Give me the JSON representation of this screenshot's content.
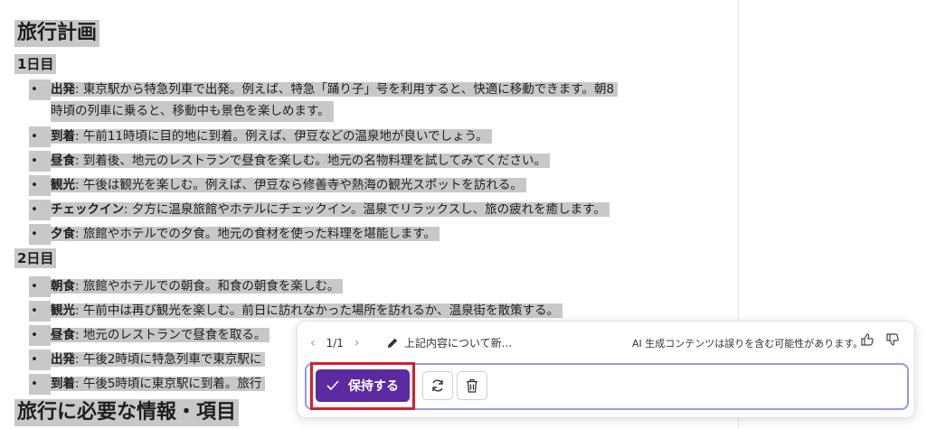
{
  "document": {
    "title": "旅行計画",
    "day1": {
      "heading": "1日目",
      "items": [
        {
          "label": "出発",
          "text": ": 東京駅から特急列車で出発。例えば、特急「踊り子」号を利用すると、快適に移動できます。朝8",
          "cont": "時頃の列車に乗ると、移動中も景色を楽しめます。"
        },
        {
          "label": "到着",
          "text": ": 午前11時頃に目的地に到着。例えば、伊豆などの温泉地が良いでしょう。"
        },
        {
          "label": "昼食",
          "text": ": 到着後、地元のレストランで昼食を楽しむ。地元の名物料理を試してみてください。"
        },
        {
          "label": "観光",
          "text": ": 午後は観光を楽しむ。例えば、伊豆なら修善寺や熱海の観光スポットを訪れる。"
        },
        {
          "label": "チェックイン",
          "text": ": 夕方に温泉旅館やホテルにチェックイン。温泉でリラックスし、旅の疲れを癒します。"
        },
        {
          "label": "夕食",
          "text": ": 旅館やホテルでの夕食。地元の食材を使った料理を堪能します。"
        }
      ]
    },
    "day2": {
      "heading": "2日目",
      "items": [
        {
          "label": "朝食",
          "text": ": 旅館やホテルでの朝食。和食の朝食を楽しむ。"
        },
        {
          "label": "観光",
          "text": ": 午前中は再び観光を楽しむ。前日に訪れなかった場所を訪れるか、温泉街を散策する。"
        },
        {
          "label": "昼食",
          "text": ": 地元のレストランで昼食を取る。"
        },
        {
          "label": "出発",
          "text": ": 午後2時頃に特急列車で東京駅に"
        },
        {
          "label": "到着",
          "text": ": 午後5時頃に東京駅に到着。旅行"
        }
      ]
    },
    "section_heading": "旅行に必要な情報・項目"
  },
  "ai_panel": {
    "pager": "1/1",
    "prompt": "上記内容について新...",
    "disclaimer": "AI 生成コンテンツは誤りを含む可能性があります。",
    "keep_label": "保持する",
    "icons": {
      "prev": "chevron-left-icon",
      "next": "chevron-right-icon",
      "pencil": "pencil-icon",
      "thumbs_up": "thumbs-up-icon",
      "thumbs_down": "thumbs-down-icon",
      "check": "check-icon",
      "regenerate": "refresh-icon",
      "delete": "trash-icon"
    },
    "colors": {
      "keep_button": "#5b2aa1",
      "highlight_box": "#d51f2f",
      "input_border": "#8f9ce8",
      "selection": "#c8c8c8"
    }
  }
}
